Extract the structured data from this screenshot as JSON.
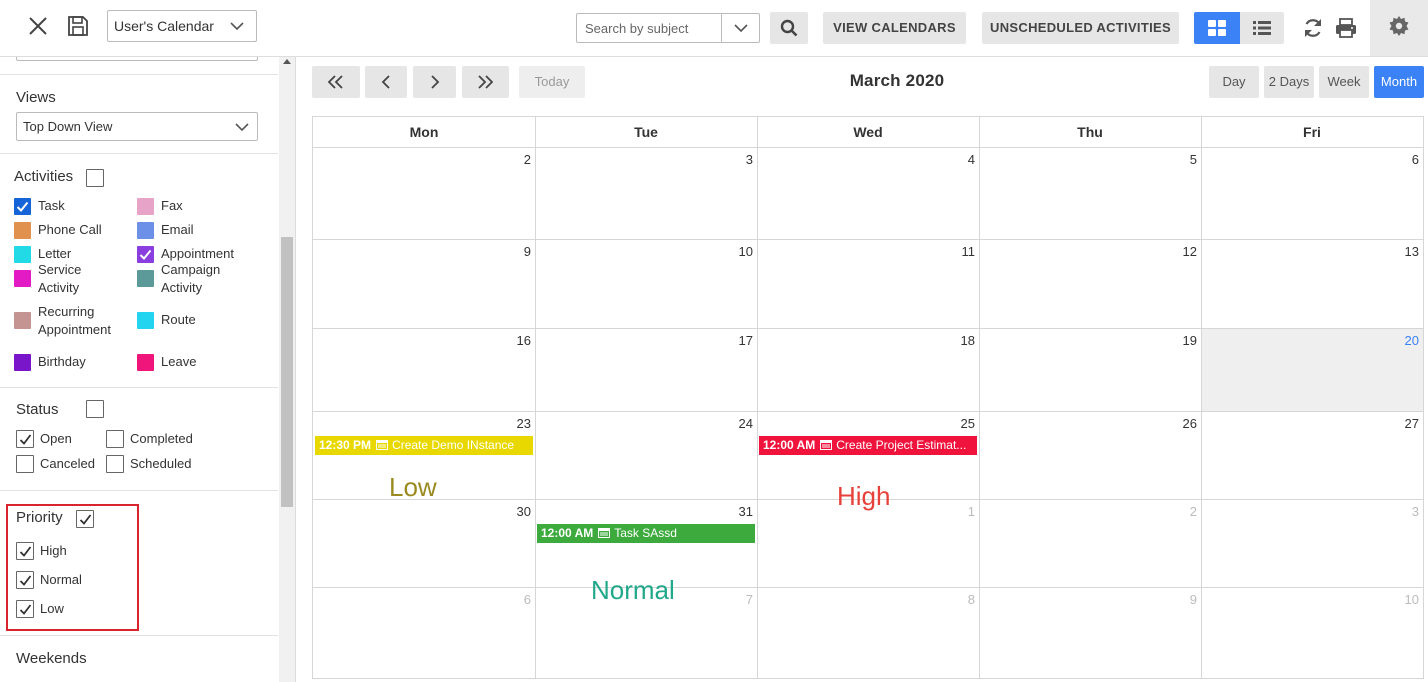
{
  "toolbar": {
    "calendar_select": "User's Calendar",
    "search_placeholder": "Search by subject",
    "view_calendars": "VIEW CALENDARS",
    "unscheduled_activities": "UNSCHEDULED ACTIVITIES"
  },
  "sidebar": {
    "views_heading": "Views",
    "views_value": "Top Down View",
    "activities_heading": "Activities",
    "activities": [
      {
        "label_lines": [
          "Task"
        ],
        "color": "#1565d8",
        "checked": true
      },
      {
        "label_lines": [
          "Fax"
        ],
        "color": "#e8a3c9",
        "checked": false
      },
      {
        "label_lines": [
          "Phone Call"
        ],
        "color": "#e0914e",
        "checked": false
      },
      {
        "label_lines": [
          "Email"
        ],
        "color": "#6c8fe8",
        "checked": false
      },
      {
        "label_lines": [
          "Letter"
        ],
        "color": "#22d9e6",
        "checked": false
      },
      {
        "label_lines": [
          "Appointment"
        ],
        "color": "#8a3ee0",
        "checked": true
      },
      {
        "label_lines": [
          "Service",
          "Activity"
        ],
        "color": "#e21bc4",
        "checked": false
      },
      {
        "label_lines": [
          "Campaign",
          "Activity"
        ],
        "color": "#5c9a9a",
        "checked": false
      },
      {
        "label_lines": [
          "Recurring",
          "Appointment"
        ],
        "color": "#c49492",
        "checked": false
      },
      {
        "label_lines": [
          "Route"
        ],
        "color": "#22d4f0",
        "checked": false
      },
      {
        "label_lines": [
          "Birthday"
        ],
        "color": "#7a16c9",
        "checked": false
      },
      {
        "label_lines": [
          "Leave"
        ],
        "color": "#f0157a",
        "checked": false
      }
    ],
    "status_heading": "Status",
    "status": {
      "open": "Open",
      "completed": "Completed",
      "canceled": "Canceled",
      "scheduled": "Scheduled"
    },
    "priority_heading": "Priority",
    "priority": {
      "high": "High",
      "normal": "Normal",
      "low": "Low"
    },
    "weekends_heading": "Weekends"
  },
  "calendar": {
    "today_label": "Today",
    "title": "March 2020",
    "ranges": [
      "Day",
      "2 Days",
      "Week",
      "Month"
    ],
    "active_range": "Month",
    "weekdays": [
      "Mon",
      "Tue",
      "Wed",
      "Thu",
      "Fri"
    ],
    "weeks": [
      [
        {
          "d": "2"
        },
        {
          "d": "3"
        },
        {
          "d": "4"
        },
        {
          "d": "5"
        },
        {
          "d": "6"
        }
      ],
      [
        {
          "d": "9"
        },
        {
          "d": "10"
        },
        {
          "d": "11"
        },
        {
          "d": "12"
        },
        {
          "d": "13"
        }
      ],
      [
        {
          "d": "16"
        },
        {
          "d": "17"
        },
        {
          "d": "18"
        },
        {
          "d": "19"
        },
        {
          "d": "20",
          "today": true
        }
      ],
      [
        {
          "d": "23"
        },
        {
          "d": "24"
        },
        {
          "d": "25"
        },
        {
          "d": "26"
        },
        {
          "d": "27"
        }
      ],
      [
        {
          "d": "30"
        },
        {
          "d": "31"
        },
        {
          "d": "1",
          "other": true
        },
        {
          "d": "2",
          "other": true
        },
        {
          "d": "3",
          "other": true
        }
      ],
      [
        {
          "d": "6",
          "other": true
        },
        {
          "d": "7",
          "other": true
        },
        {
          "d": "8",
          "other": true
        },
        {
          "d": "9",
          "other": true
        },
        {
          "d": "10",
          "other": true
        }
      ]
    ],
    "events": [
      {
        "time": "12:30 PM",
        "title": "Create Demo INstance",
        "color": "#e8d800",
        "week": 3,
        "day": 0
      },
      {
        "time": "12:00 AM",
        "title": "Create Project Estimat...",
        "color": "#f0143c",
        "week": 3,
        "day": 2
      },
      {
        "time": "12:00 AM",
        "title": "Task SAssd",
        "color": "#3daa3d",
        "week": 4,
        "day": 1
      }
    ],
    "annotations": [
      {
        "text": "Low",
        "color": "#9a8a20"
      },
      {
        "text": "High",
        "color": "#e8403a"
      },
      {
        "text": "Normal",
        "color": "#21a88a"
      }
    ]
  }
}
